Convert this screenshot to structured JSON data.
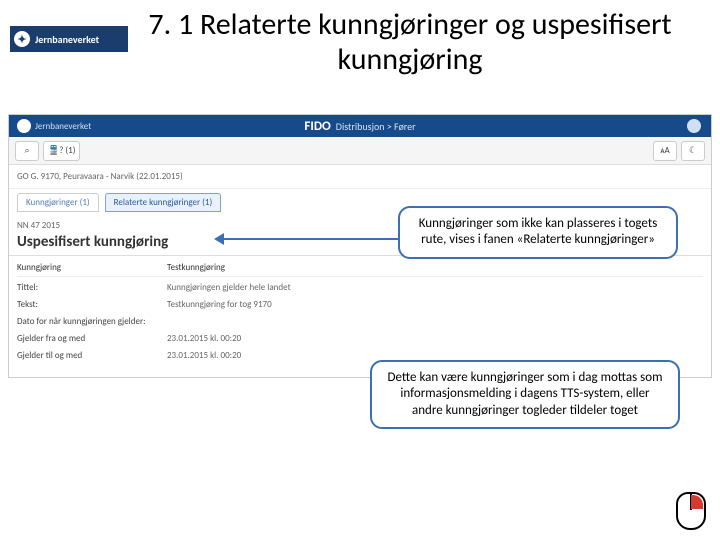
{
  "logo": {
    "text": "Jernbaneverket"
  },
  "title": "7. 1 Relaterte kunngjøringer og uspesifisert kunngjøring",
  "app": {
    "brand": "Jernbaneverket",
    "name": "FIDO",
    "sub": "Distribusjon > Fører"
  },
  "toolbar": {
    "search_icon": "⌕",
    "train_btn": "🚆? (1)",
    "font_btn": "ᴀA",
    "theme_btn": "☾"
  },
  "breadcrumb": "GO G. 9170, Peuravaara - Narvik (22.01.2015)",
  "tabs": [
    {
      "label": "Kunngjøringer (1)"
    },
    {
      "label": "Relaterte kunngjøringer (1)"
    }
  ],
  "section_id": "NN 47 2015",
  "section_title": "Uspesifisert kunngjøring",
  "form": {
    "header_col1": "Kunngjøring",
    "header_col2": "Testkunngjøring",
    "rows": [
      {
        "label": "Tittel:",
        "value": "Kunngjøringen gjelder hele landet"
      },
      {
        "label": "Tekst:",
        "value": "Testkunngjøring for tog 9170"
      },
      {
        "label": "Dato for når kunngjøringen gjelder:",
        "value": ""
      },
      {
        "label": "Gjelder fra og med",
        "value": "23.01.2015 kl. 00:20"
      },
      {
        "label": "Gjelder til og med",
        "value": "23.01.2015 kl. 00:20"
      }
    ]
  },
  "callouts": {
    "c1": "Kunngjøringer som ikke kan plasseres i togets rute, vises i fanen «Relaterte kunngjøringer»",
    "c2": "Dette kan være kunngjøringer som i dag mottas som informasjonsmelding i dagens TTS-system, eller andre kunngjøringer togleder tildeler toget"
  }
}
